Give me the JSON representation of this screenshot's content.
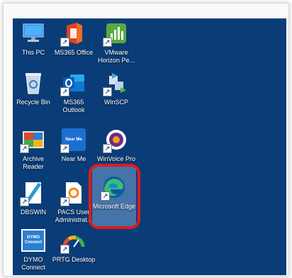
{
  "desktop_icons": [
    {
      "label": "This PC",
      "icon": "this-pc-icon"
    },
    {
      "label": "MS365 Office",
      "icon": "ms365-office-icon"
    },
    {
      "label": "VMware Horizon Pe...",
      "icon": "vmware-horizon-icon"
    },
    {
      "label": "Recycle Bin",
      "icon": "recycle-bin-icon"
    },
    {
      "label": "MS365 Outlook",
      "icon": "outlook-icon"
    },
    {
      "label": "WinSCP",
      "icon": "winscp-icon"
    },
    {
      "label": "Archive Reader",
      "icon": "archive-reader-icon"
    },
    {
      "label": "Near Me",
      "icon": "near-me-icon",
      "icon_text": "Near Me"
    },
    {
      "label": "WinVoice Pro",
      "icon": "winvoice-pro-icon"
    },
    {
      "label": "DBSWIN",
      "icon": "dbswin-icon"
    },
    {
      "label": "PACS User Administrat...",
      "icon": "pacs-icon"
    },
    {
      "label": "Microsoft Edge",
      "icon": "edge-icon",
      "selected": true
    },
    {
      "label": "DYMO Connect",
      "icon": "dymo-icon",
      "icon_text": "DYMO Connect"
    },
    {
      "label": "PRTG Desktop",
      "icon": "prtg-icon"
    }
  ],
  "colors": {
    "desktop_bg": "#0a3d78",
    "highlight": "#e21a1a"
  }
}
